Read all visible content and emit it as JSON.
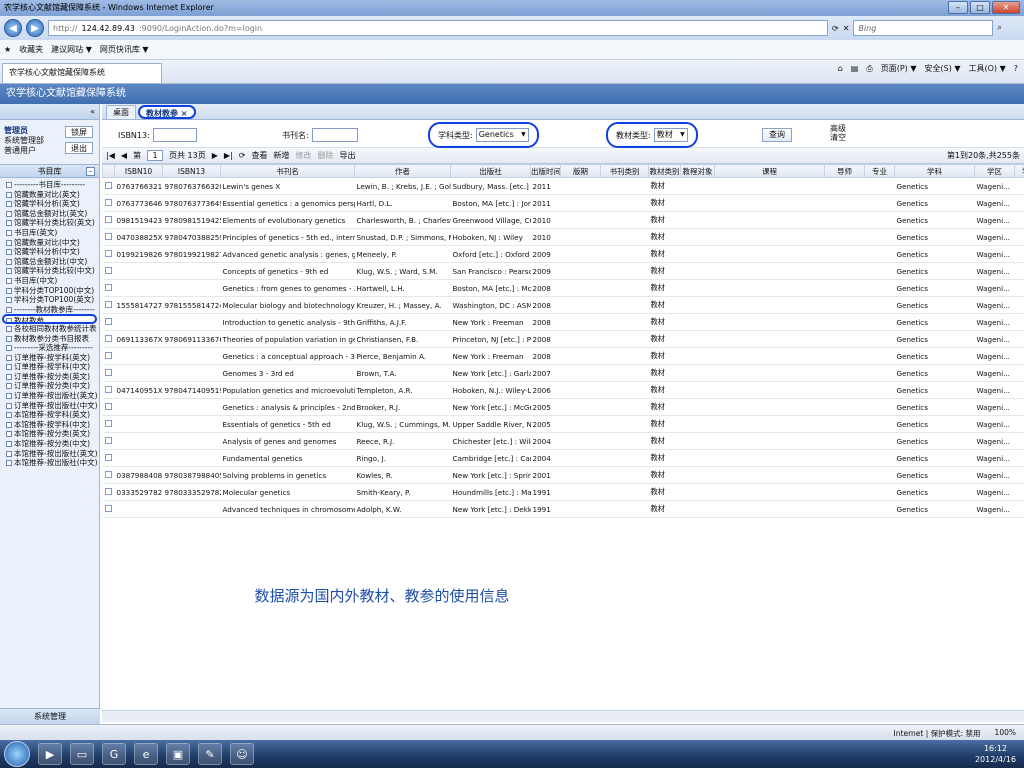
{
  "window": {
    "title": "农学核心文献馆藏保障系统 - Windows Internet Explorer"
  },
  "browser": {
    "url_prefix": "http://",
    "url_host": "124.42.89.43",
    "url_rest": ":9090/LoginAction.do?m=login",
    "search_placeholder": "Bing",
    "fav_label": "收藏夹",
    "fav_items": [
      "建议网站 ▼",
      "网页快讯库 ▼"
    ],
    "tab_label": "农学核心文献馆藏保障系统",
    "cmd_items": [
      "页面(P) ▼",
      "安全(S) ▼",
      "工具(O) ▼"
    ]
  },
  "app": {
    "title": "农学核心文献馆藏保障系统"
  },
  "left": {
    "collapse": "«",
    "user_role1": "管理员",
    "user_role2": "系统管理部",
    "user_role3": "普通用户",
    "btn_lock": "锁屏",
    "btn_exit": "退出",
    "lib_header": "书目库",
    "tree": [
      "---------书目库---------",
      "馆藏数量对比(英文)",
      "馆藏学科分析(英文)",
      "馆藏总金额对比(英文)",
      "馆藏学科分类比较(英文)",
      "书目库(英文)",
      "馆藏数量对比(中文)",
      "馆藏学科分析(中文)",
      "馆藏总金额对比(中文)",
      "馆藏学科分类比较(中文)",
      "书目库(中文)",
      "学科分类TOP100(中文)",
      "学科分类TOP100(英文)",
      "--------教材教参库--------",
      "教材教参",
      "各校相同教材教参统计表",
      "教材教参分类书目报表",
      "---------采选推荐---------",
      "订单推荐-按学科(英文)",
      "订单推荐-按学科(中文)",
      "订单推荐-按分类(英文)",
      "订单推荐-按分类(中文)",
      "订单推荐-按出版社(英文)",
      "订单推荐-按出版社(中文)",
      "本馆推荐-按学科(英文)",
      "本馆推荐-按学科(中文)",
      "本馆推荐-按分类(英文)",
      "本馆推荐-按分类(中文)",
      "本馆推荐-按出版社(英文)",
      "本馆推荐-按出版社(中文)"
    ],
    "selected_index": 14,
    "sys_manage": "系统管理"
  },
  "tabs": [
    {
      "label": "桌面"
    },
    {
      "label": "教材教参 ×"
    }
  ],
  "filters": {
    "isbn_label": "ISBN13:",
    "title_label": "书刊名:",
    "subject_label": "学科类型:",
    "subject_value": "Genetics",
    "material_label": "教材类型:",
    "material_value": "教材",
    "query_btn": "查询",
    "advanced": "高级",
    "clear": "清空"
  },
  "toolbar": {
    "page_prefix": "第",
    "page_num": "1",
    "page_total": "页共 13页",
    "view": "查看",
    "add": "新增",
    "edit": "修改",
    "delete": "删除",
    "export": "导出",
    "count": "第1到20条,共255条"
  },
  "table": {
    "columns": [
      "ISBN10",
      "ISBN13",
      "书刊名",
      "作者",
      "出版社",
      "出版时间",
      "版期",
      "书刊类别",
      "教材类别",
      "教程对象",
      "课程",
      "导师",
      "专业",
      "学科",
      "学区",
      "学校"
    ],
    "rows": [
      [
        "0763766321",
        "9780763766320",
        "Lewin's genes X",
        "Lewin, B. ; Krebs, J.E. ; Goldst...",
        "Sudbury, Mass. [etc.] : Jo...",
        "2011",
        "",
        "",
        "教材",
        "",
        "",
        "",
        "",
        "Genetics",
        "Wageni...",
        ""
      ],
      [
        "0763773646",
        "9780763773649",
        "Essential genetics : a genomics perspecti...",
        "Hartl, D.L.",
        "Boston, MA [etc.] : Jones ...",
        "2011",
        "",
        "",
        "教材",
        "",
        "",
        "",
        "",
        "Genetics",
        "Wageni...",
        ""
      ],
      [
        "0981519423",
        "9780981519425",
        "Elements of evolutionary genetics",
        "Charlesworth, B. ; Charleswor...",
        "Greenwood Village, CO : ...",
        "2010",
        "",
        "",
        "教材",
        "",
        "",
        "",
        "",
        "Genetics",
        "Wageni...",
        ""
      ],
      [
        "047038825X",
        "9780470388259",
        "Principles of genetics - 5th ed., internation...",
        "Snustad, D.P. ; Simmons, M.J.",
        "Hoboken, NJ : Wiley",
        "2010",
        "",
        "",
        "教材",
        "",
        "",
        "",
        "",
        "Genetics",
        "Wageni...",
        ""
      ],
      [
        "0199219826",
        "9780199219827",
        "Advanced genetic analysis : genes, genom...",
        "Meneely, P.",
        "Oxford [etc.] : Oxford Univ...",
        "2009",
        "",
        "",
        "教材",
        "",
        "",
        "",
        "",
        "Genetics",
        "Wageni...",
        ""
      ],
      [
        "",
        "",
        "Concepts of genetics - 9th ed",
        "Klug, W.S. ; Ward, S.M.",
        "San Francisco : Pearso...",
        "2009",
        "",
        "",
        "教材",
        "",
        "",
        "",
        "",
        "Genetics",
        "Wageni...",
        ""
      ],
      [
        "",
        "",
        "Genetics : from genes to genomes - 3rd. ed",
        "Hartwell, L.H.",
        "Boston, MA [etc.] : McGra...",
        "2008",
        "",
        "",
        "教材",
        "",
        "",
        "",
        "",
        "Genetics",
        "Wageni...",
        ""
      ],
      [
        "1555814727",
        "9781555814724",
        "Molecular biology and biotechnology : a gui...",
        "Kreuzer, H. ; Massey, A.",
        "Washington, DC : ASM",
        "2008",
        "",
        "",
        "教材",
        "",
        "",
        "",
        "",
        "Genetics",
        "Wageni...",
        ""
      ],
      [
        "",
        "",
        "Introduction to genetic analysis - 9th ed",
        "Griffiths, A.J.F.",
        "New York : Freeman",
        "2008",
        "",
        "",
        "教材",
        "",
        "",
        "",
        "",
        "Genetics",
        "Wageni...",
        ""
      ],
      [
        "069113367X",
        "9780691133676",
        "Theories of population variation in genes a...",
        "Christiansen, F.B.",
        "Princeton, NJ [etc.] : Prin...",
        "2008",
        "",
        "",
        "教材",
        "",
        "",
        "",
        "",
        "Genetics",
        "Wageni...",
        ""
      ],
      [
        "",
        "",
        "Genetics : a conceptual approach - 3rd ed",
        "Pierce, Benjamin A.",
        "New York : Freeman",
        "2008",
        "",
        "",
        "教材",
        "",
        "",
        "",
        "",
        "Genetics",
        "Wageni...",
        ""
      ],
      [
        "",
        "",
        "Genomes 3 - 3rd ed",
        "Brown, T.A.",
        "New York [etc.] : Garland...",
        "2007",
        "",
        "",
        "教材",
        "",
        "",
        "",
        "",
        "Genetics",
        "Wageni...",
        ""
      ],
      [
        "047140951X",
        "9780471409519",
        "Population genetics and microevolutionary...",
        "Templeton, A.R.",
        "Hoboken, N.J.: Wiley-Liss",
        "2006",
        "",
        "",
        "教材",
        "",
        "",
        "",
        "",
        "Genetics",
        "Wageni...",
        ""
      ],
      [
        "",
        "",
        "Genetics : analysis & principles - 2nd ed",
        "Brooker, R.J.",
        "New York [etc.] : McGraw...",
        "2005",
        "",
        "",
        "教材",
        "",
        "",
        "",
        "",
        "Genetics",
        "Wageni...",
        ""
      ],
      [
        "",
        "",
        "Essentials of genetics - 5th ed",
        "Klug, W.S. ; Cummings, M.R.",
        "Upper Saddle River, NJ [...",
        "2005",
        "",
        "",
        "教材",
        "",
        "",
        "",
        "",
        "Genetics",
        "Wageni...",
        ""
      ],
      [
        "",
        "",
        "Analysis of genes and genomes",
        "Reece, R.J.",
        "Chichester [etc.] : Wiley",
        "2004",
        "",
        "",
        "教材",
        "",
        "",
        "",
        "",
        "Genetics",
        "Wageni...",
        ""
      ],
      [
        "",
        "",
        "Fundamental genetics",
        "Ringo, J.",
        "Cambridge [etc.] : Camb...",
        "2004",
        "",
        "",
        "教材",
        "",
        "",
        "",
        "",
        "Genetics",
        "Wageni...",
        ""
      ],
      [
        "0387988408",
        "9780387988405",
        "Solving problems in genetics",
        "Kowles, R.",
        "New York [etc.] : Springe...",
        "2001",
        "",
        "",
        "教材",
        "",
        "",
        "",
        "",
        "Genetics",
        "Wageni...",
        ""
      ],
      [
        "0333529782",
        "9780333529782",
        "Molecular genetics",
        "Smith-Keary, P.",
        "Houndmills [etc.] : Macm...",
        "1991",
        "",
        "",
        "教材",
        "",
        "",
        "",
        "",
        "Genetics",
        "Wageni...",
        ""
      ],
      [
        "",
        "",
        "Advanced techniques in chromosome res...",
        "Adolph, K.W.",
        "New York [etc.] : Dekker",
        "1991",
        "",
        "",
        "教材",
        "",
        "",
        "",
        "",
        "Genetics",
        "Wageni...",
        ""
      ]
    ]
  },
  "caption": "数据源为国内外教材、教参的使用信息",
  "status": {
    "zone": "Internet | 保护模式: 禁用",
    "zoom": "100%"
  },
  "taskbar": {
    "time": "16:12",
    "date": "2012/4/16"
  },
  "colors": {
    "highlight": "#1040e0",
    "app_bar": "#4a79b8"
  }
}
